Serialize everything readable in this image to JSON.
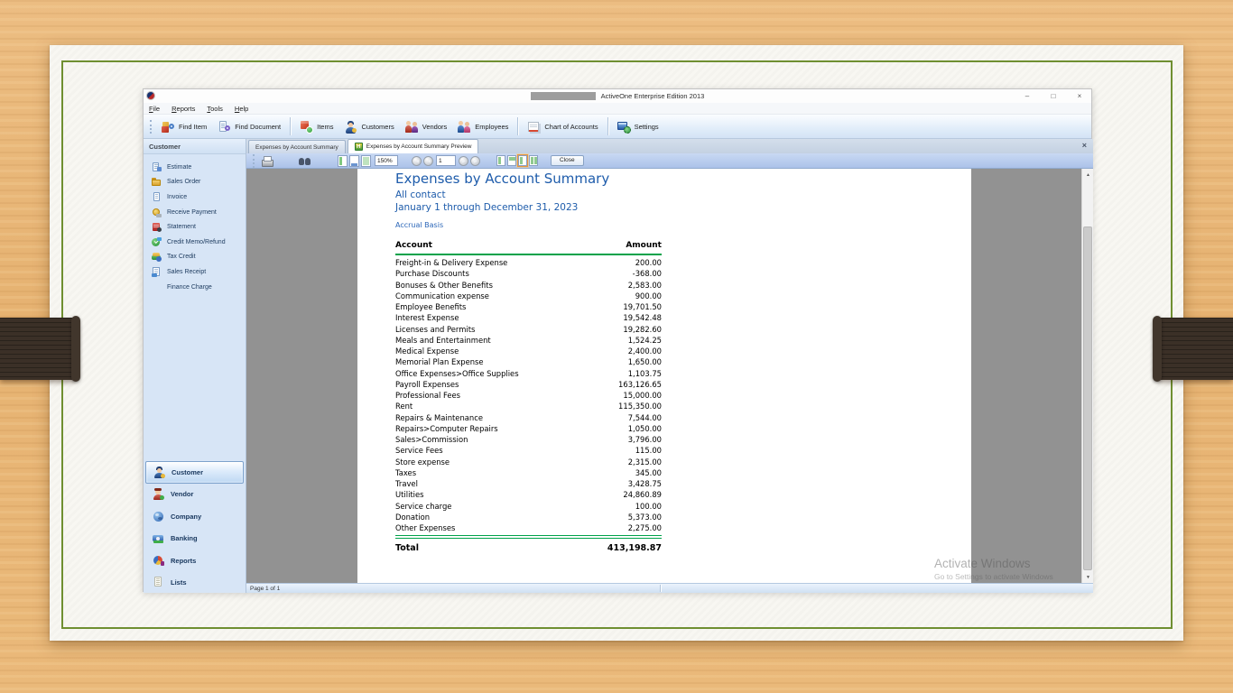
{
  "window": {
    "title": "ActiveOne Enterprise Edition 2013",
    "controls": {
      "minimize": "–",
      "maximize": "□",
      "close": "×"
    }
  },
  "menu": {
    "items": [
      {
        "label": "File"
      },
      {
        "label": "Reports"
      },
      {
        "label": "Tools"
      },
      {
        "label": "Help"
      }
    ]
  },
  "toolbar": {
    "buttons": [
      {
        "label": "Find Item",
        "icon": "find-item-icon"
      },
      {
        "label": "Find Document",
        "icon": "find-document-icon",
        "separator_after": true
      },
      {
        "label": "Items",
        "icon": "items-icon"
      },
      {
        "label": "Customers",
        "icon": "customers-icon"
      },
      {
        "label": "Vendors",
        "icon": "vendors-icon"
      },
      {
        "label": "Employees",
        "icon": "employees-icon",
        "separator_after": true
      },
      {
        "label": "Chart of Accounts",
        "icon": "chart-of-accounts-icon",
        "separator_after": true
      },
      {
        "label": "Settings",
        "icon": "settings-icon"
      }
    ]
  },
  "sidebar": {
    "header": "Customer",
    "items": [
      {
        "label": "Estimate",
        "icon": "estimate-icon"
      },
      {
        "label": "Sales Order",
        "icon": "sales-order-icon"
      },
      {
        "label": "Invoice",
        "icon": "invoice-icon"
      },
      {
        "label": "Receive Payment",
        "icon": "receive-payment-icon"
      },
      {
        "label": "Statement",
        "icon": "statement-icon"
      },
      {
        "label": "Credit Memo/Refund",
        "icon": "credit-memo-icon"
      },
      {
        "label": "Tax Credit",
        "icon": "tax-credit-icon"
      },
      {
        "label": "Sales Receipt",
        "icon": "sales-receipt-icon"
      },
      {
        "label": "Finance Charge",
        "icon": "blank-icon"
      }
    ],
    "nav": [
      {
        "label": "Customer",
        "icon": "customer-nav-icon"
      },
      {
        "label": "Vendor",
        "icon": "vendor-nav-icon"
      },
      {
        "label": "Company",
        "icon": "company-nav-icon"
      },
      {
        "label": "Banking",
        "icon": "banking-nav-icon"
      },
      {
        "label": "Reports",
        "icon": "reports-nav-icon"
      },
      {
        "label": "Lists",
        "icon": "lists-nav-icon"
      }
    ],
    "nav_selected": "Customer"
  },
  "tabs": [
    {
      "label": "Expenses by Account Summary",
      "active": false
    },
    {
      "label": "Expenses by Account Summary Preview",
      "active": true
    }
  ],
  "preview_toolbar": {
    "zoom": "150%",
    "page": "1",
    "close_label": "Close"
  },
  "report": {
    "title": "Expenses by Account Summary",
    "subtitle": "All contact",
    "date_range": "January 1 through December 31, 2023",
    "basis": "Accrual Basis",
    "columns": [
      "Account",
      "Amount"
    ],
    "rows": [
      {
        "account": "Freight-in & Delivery Expense",
        "amount": "200.00"
      },
      {
        "account": "Purchase Discounts",
        "amount": "-368.00"
      },
      {
        "account": "Bonuses & Other Benefits",
        "amount": "2,583.00"
      },
      {
        "account": "Communication expense",
        "amount": "900.00"
      },
      {
        "account": "Employee Benefits",
        "amount": "19,701.50"
      },
      {
        "account": "Interest Expense",
        "amount": "19,542.48"
      },
      {
        "account": "Licenses and Permits",
        "amount": "19,282.60"
      },
      {
        "account": "Meals and Entertainment",
        "amount": "1,524.25"
      },
      {
        "account": "Medical Expense",
        "amount": "2,400.00"
      },
      {
        "account": "Memorial Plan Expense",
        "amount": "1,650.00"
      },
      {
        "account": "Office Expenses>Office Supplies",
        "amount": "1,103.75"
      },
      {
        "account": "Payroll Expenses",
        "amount": "163,126.65"
      },
      {
        "account": "Professional Fees",
        "amount": "15,000.00"
      },
      {
        "account": "Rent",
        "amount": "115,350.00"
      },
      {
        "account": "Repairs & Maintenance",
        "amount": "7,544.00"
      },
      {
        "account": "Repairs>Computer Repairs",
        "amount": "1,050.00"
      },
      {
        "account": "Sales>Commission",
        "amount": "3,796.00"
      },
      {
        "account": "Service Fees",
        "amount": "115.00"
      },
      {
        "account": "Store expense",
        "amount": "2,315.00"
      },
      {
        "account": "Taxes",
        "amount": "345.00"
      },
      {
        "account": "Travel",
        "amount": "3,428.75"
      },
      {
        "account": "Utilities",
        "amount": "24,860.89"
      },
      {
        "account": "Service charge",
        "amount": "100.00"
      },
      {
        "account": "Donation",
        "amount": "5,373.00"
      },
      {
        "account": "Other Expenses",
        "amount": "2,275.00"
      }
    ],
    "total_label": "Total",
    "total_value": "413,198.87"
  },
  "status_bar": {
    "page_info": "Page 1 of 1"
  },
  "watermark": {
    "line1": "Activate Windows",
    "line2": "Go to Settings to activate Windows"
  },
  "colors": {
    "report_title_blue": "#1e5cab",
    "report_line_green": "#00a24a",
    "sidebar_blue": "#d7e5f6",
    "preview_gray": "#929292",
    "wood_tan": "#e6b271",
    "frame_green": "#6f8f31",
    "strap_brown": "#3b3027"
  }
}
